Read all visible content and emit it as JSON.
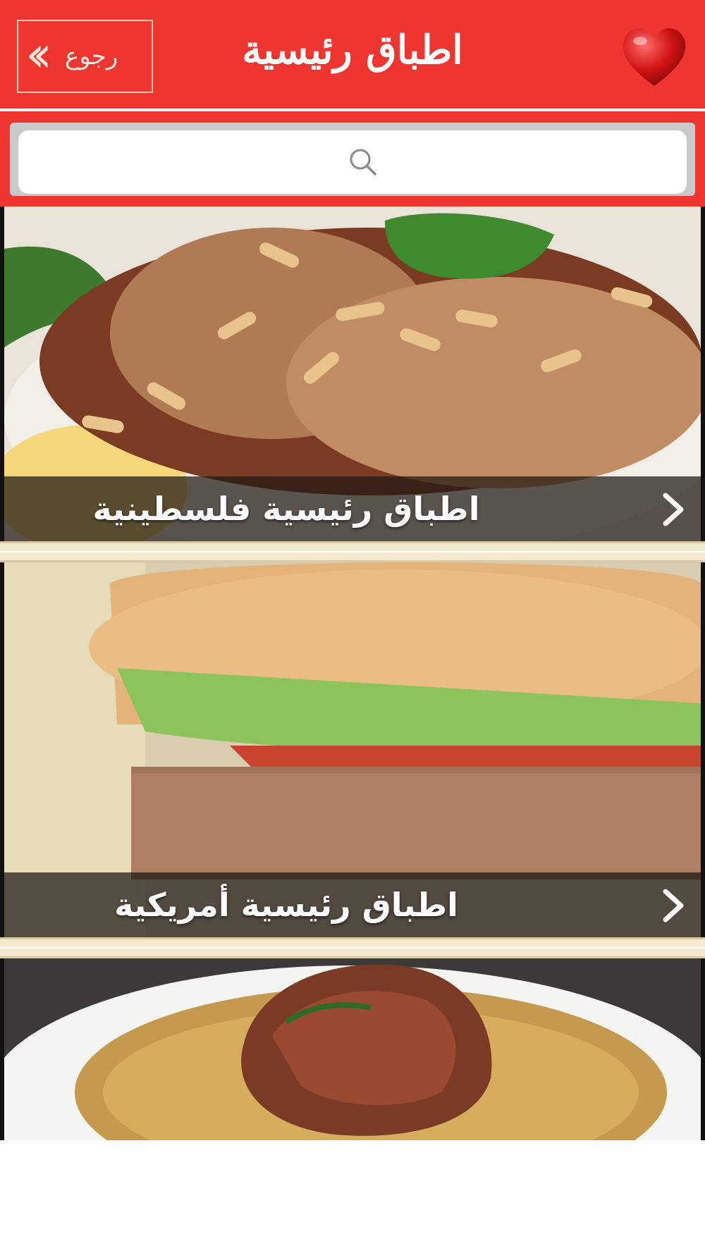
{
  "header": {
    "title": "اطباق رئيسية",
    "back_label": "رجوع"
  },
  "search": {
    "placeholder": ""
  },
  "categories": [
    {
      "label": "اطباق رئيسية فلسطينية"
    },
    {
      "label": "اطباق رئيسية أمريكية"
    },
    {
      "label": ""
    }
  ],
  "colors": {
    "accent": "#ef3530",
    "separator": "#f3e9cf"
  }
}
